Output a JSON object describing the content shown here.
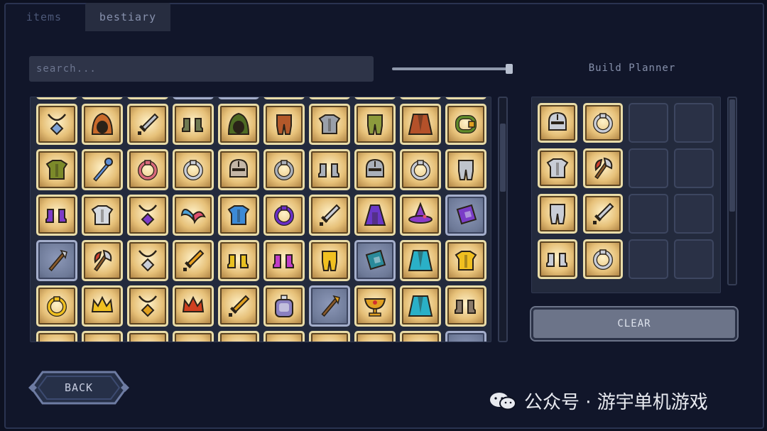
{
  "tabs": [
    {
      "label": "items"
    },
    {
      "label": "bestiary"
    }
  ],
  "search": {
    "placeholder": "search..."
  },
  "build_planner": {
    "title": "Build Planner",
    "clear_label": "CLEAR",
    "slots": [
      {
        "icon": "helmet-icon",
        "bg": "gold"
      },
      {
        "icon": "ring-icon",
        "bg": "gold"
      },
      {
        "icon": "",
        "bg": "empty"
      },
      {
        "icon": "",
        "bg": "empty"
      },
      {
        "icon": "chest-armor-icon",
        "bg": "gold"
      },
      {
        "icon": "axe-icon",
        "bg": "gold"
      },
      {
        "icon": "",
        "bg": "empty"
      },
      {
        "icon": "",
        "bg": "empty"
      },
      {
        "icon": "leg-armor-icon",
        "bg": "gold"
      },
      {
        "icon": "sword-icon",
        "bg": "gold"
      },
      {
        "icon": "",
        "bg": "empty"
      },
      {
        "icon": "",
        "bg": "empty"
      },
      {
        "icon": "boots-icon",
        "bg": "gold"
      },
      {
        "icon": "ring-icon",
        "bg": "gold"
      },
      {
        "icon": "",
        "bg": "empty"
      },
      {
        "icon": "",
        "bg": "empty"
      }
    ]
  },
  "back_label": "BACK",
  "watermark": "公众号 · 游宇单机游戏",
  "items": [
    {
      "icon": "ring-icon",
      "bg": "gold"
    },
    {
      "icon": "ring-icon",
      "bg": "gold"
    },
    {
      "icon": "ring-icon",
      "bg": "gold"
    },
    {
      "icon": "",
      "bg": "blue"
    },
    {
      "icon": "",
      "bg": "blue"
    },
    {
      "icon": "ring-icon",
      "bg": "gold"
    },
    {
      "icon": "ring-icon",
      "bg": "gold"
    },
    {
      "icon": "ring-icon",
      "bg": "gold"
    },
    {
      "icon": "ring-icon",
      "bg": "gold"
    },
    {
      "icon": "ring-icon",
      "bg": "gold"
    },
    {
      "icon": "amulet-icon",
      "bg": "gold",
      "color": "#7fa3d6"
    },
    {
      "icon": "hood-icon",
      "bg": "gold",
      "color": "#c96a2b"
    },
    {
      "icon": "sword-icon",
      "bg": "gold",
      "color": "#bfc4cc"
    },
    {
      "icon": "boots-icon",
      "bg": "gold",
      "color": "#6f7a52"
    },
    {
      "icon": "hood-icon",
      "bg": "gold",
      "color": "#4e6b24"
    },
    {
      "icon": "leg-armor-icon",
      "bg": "gold",
      "color": "#b3582a"
    },
    {
      "icon": "chest-armor-icon",
      "bg": "gold",
      "color": "#9aa0aa"
    },
    {
      "icon": "leg-armor-icon",
      "bg": "gold",
      "color": "#8c9a3c"
    },
    {
      "icon": "cape-icon",
      "bg": "gold",
      "color": "#b4512a"
    },
    {
      "icon": "bracelet-icon",
      "bg": "gold",
      "color": "#5f8a2a"
    },
    {
      "icon": "chest-armor-icon",
      "bg": "gold",
      "color": "#7c8a2a"
    },
    {
      "icon": "staff-icon",
      "bg": "gold",
      "color": "#5d8fd6"
    },
    {
      "icon": "ring-icon",
      "bg": "gold",
      "color": "#d96a7c"
    },
    {
      "icon": "ring-icon",
      "bg": "gold",
      "color": "#c9cdd6"
    },
    {
      "icon": "helmet-icon",
      "bg": "gold",
      "color": "#c4b6a6"
    },
    {
      "icon": "ring-icon",
      "bg": "gold",
      "color": "#aab0ba"
    },
    {
      "icon": "boots-icon",
      "bg": "gold",
      "color": "#aab0ba"
    },
    {
      "icon": "helmet-icon",
      "bg": "gold",
      "color": "#aab0ba"
    },
    {
      "icon": "ring-icon",
      "bg": "gold",
      "color": "#c9cdd6"
    },
    {
      "icon": "leg-armor-icon",
      "bg": "gold",
      "color": "#bfc4cc"
    },
    {
      "icon": "boots-icon",
      "bg": "gold",
      "color": "#7d3cc7"
    },
    {
      "icon": "chest-armor-icon",
      "bg": "gold",
      "color": "#d6dae0"
    },
    {
      "icon": "amulet-icon",
      "bg": "gold",
      "color": "#7d3cc7"
    },
    {
      "icon": "wings-icon",
      "bg": "gold",
      "color": "#4aa0d6"
    },
    {
      "icon": "chest-armor-icon",
      "bg": "gold",
      "color": "#3c8ad6"
    },
    {
      "icon": "ring-icon",
      "bg": "gold",
      "color": "#6a2ec7"
    },
    {
      "icon": "sword-icon",
      "bg": "gold",
      "color": "#c9cdd6"
    },
    {
      "icon": "robe-icon",
      "bg": "gold",
      "color": "#6a38c7"
    },
    {
      "icon": "wizard-hat-icon",
      "bg": "gold",
      "color": "#8a3cc7"
    },
    {
      "icon": "book-icon",
      "bg": "blue",
      "color": "#7a3cc7"
    },
    {
      "icon": "wand-icon",
      "bg": "blue",
      "color": "#c9cdd6"
    },
    {
      "icon": "axe-icon",
      "bg": "gold",
      "color": "#c9cdd6"
    },
    {
      "icon": "amulet-icon",
      "bg": "gold",
      "color": "#c9cdd6"
    },
    {
      "icon": "sword-icon",
      "bg": "gold",
      "color": "#e8a020"
    },
    {
      "icon": "boots-icon",
      "bg": "gold",
      "color": "#e8c020"
    },
    {
      "icon": "boots-icon",
      "bg": "gold",
      "color": "#c03cc7"
    },
    {
      "icon": "leg-armor-icon",
      "bg": "gold",
      "color": "#f0c020"
    },
    {
      "icon": "book-icon",
      "bg": "blue",
      "color": "#2a8a9a"
    },
    {
      "icon": "cape-icon",
      "bg": "gold",
      "color": "#2ab0c7"
    },
    {
      "icon": "chest-armor-icon",
      "bg": "gold",
      "color": "#f0c020"
    },
    {
      "icon": "ring-icon",
      "bg": "gold",
      "color": "#f0c020"
    },
    {
      "icon": "crown-icon",
      "bg": "gold",
      "color": "#f0c020"
    },
    {
      "icon": "amulet-icon",
      "bg": "gold",
      "color": "#e0a020"
    },
    {
      "icon": "crown-icon",
      "bg": "gold",
      "color": "#d04020"
    },
    {
      "icon": "sword-icon",
      "bg": "gold",
      "color": "#e0a020"
    },
    {
      "icon": "potion-icon",
      "bg": "gold",
      "color": "#8a80c0"
    },
    {
      "icon": "wand-icon",
      "bg": "blue",
      "color": "#e0a020"
    },
    {
      "icon": "chalice-icon",
      "bg": "gold",
      "color": "#e0a020"
    },
    {
      "icon": "cape-icon",
      "bg": "gold",
      "color": "#2ab0c7"
    },
    {
      "icon": "boots-icon",
      "bg": "gold",
      "color": "#8a7a6a"
    },
    {
      "icon": "",
      "bg": "gold"
    },
    {
      "icon": "",
      "bg": "gold"
    },
    {
      "icon": "",
      "bg": "gold"
    },
    {
      "icon": "",
      "bg": "gold"
    },
    {
      "icon": "",
      "bg": "gold"
    },
    {
      "icon": "",
      "bg": "gold"
    },
    {
      "icon": "",
      "bg": "gold"
    },
    {
      "icon": "",
      "bg": "gold"
    },
    {
      "icon": "",
      "bg": "gold"
    },
    {
      "icon": "",
      "bg": "blue"
    }
  ]
}
